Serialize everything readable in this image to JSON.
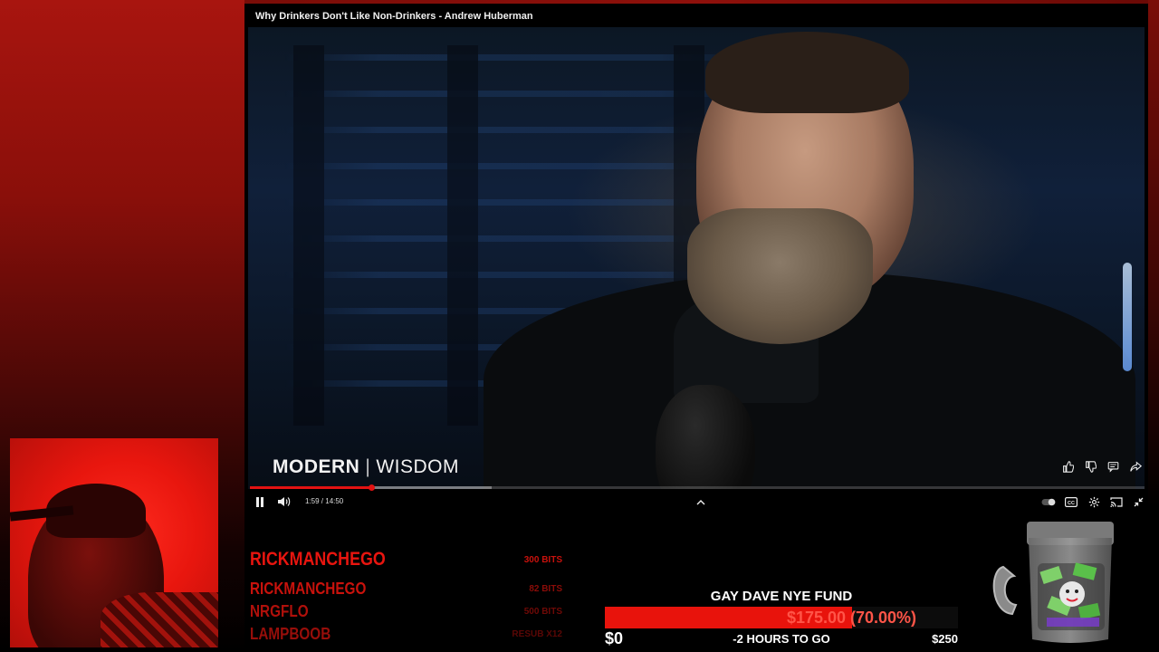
{
  "player": {
    "title": "Why Drinkers Don't Like Non-Drinkers - Andrew Huberman",
    "watermark_bold": "MODERN",
    "watermark_sep": "|",
    "watermark_light": "WISDOM",
    "current_time": "1:59",
    "duration": "14:50",
    "time_display": "1:59 / 14:50",
    "progress": 0.136,
    "buffered": 0.27,
    "controls": {
      "play_state": "playing",
      "icons": [
        "pause-icon",
        "volume-icon",
        "chevron-up-icon",
        "autoplay-toggle-icon",
        "captions-icon",
        "settings-icon",
        "cast-icon",
        "exit-fullscreen-icon"
      ]
    },
    "side_actions": [
      "like-icon",
      "dislike-icon",
      "comment-icon",
      "share-icon"
    ]
  },
  "alerts": [
    {
      "name": "RICKMANCHEGO",
      "value": "300 BITS"
    },
    {
      "name": "RICKMANCHEGO",
      "value": "82 BITS"
    },
    {
      "name": "NRGFLO",
      "value": "500 BITS"
    },
    {
      "name": "LAMPBOOB",
      "value": "RESUB X12"
    }
  ],
  "goal": {
    "title": "GAY DAVE NYE FUND",
    "amount_text": "$175.00 (70.00%)",
    "fraction": 0.7,
    "min_label": "$0",
    "time_left": "-2 HOURS TO GO",
    "max_label": "$250"
  },
  "colors": {
    "accent_red": "#e31212",
    "alert_red": "#e8150f",
    "goal_fill": "#e8130c"
  }
}
